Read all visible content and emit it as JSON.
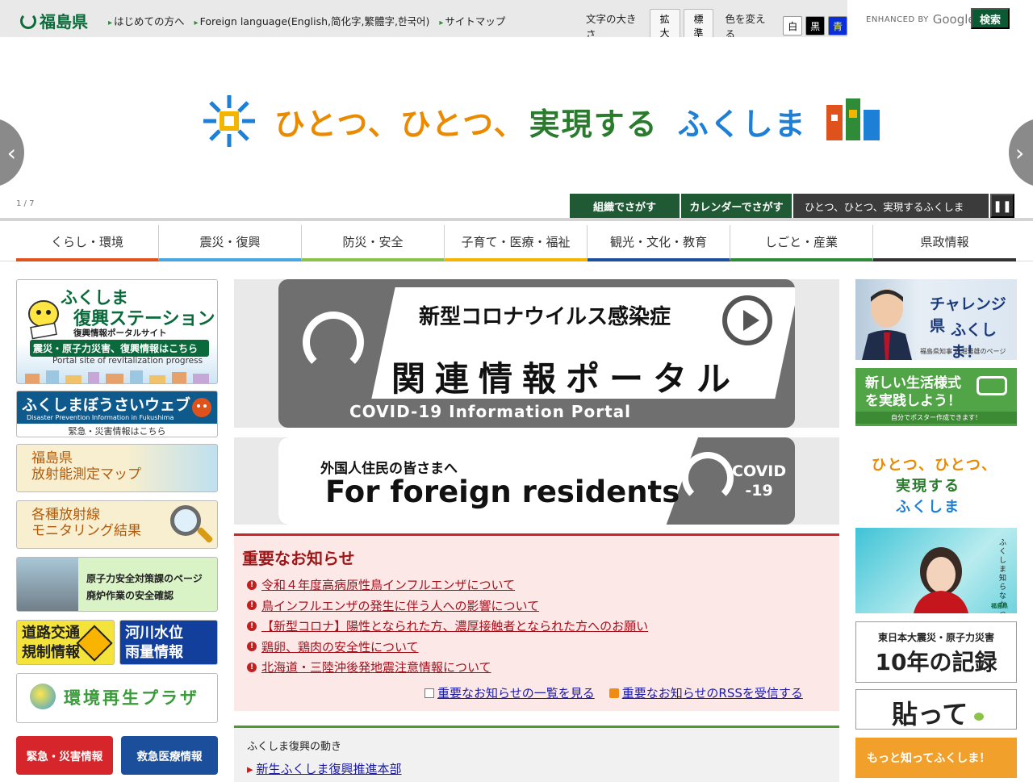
{
  "header": {
    "logo": "福島県",
    "links": [
      "はじめての方へ",
      "Foreign language(English,简化字,繁體字,한국어)",
      "サイトマップ"
    ],
    "font_size_label": "文字の大きさ",
    "font_size_buttons": [
      "拡大",
      "標準"
    ],
    "color_label": "色を変える",
    "color_buttons": [
      "白",
      "黒",
      "青"
    ],
    "search_enhanced": "ENHANCED BY",
    "search_google": "Google",
    "search_button": "検索"
  },
  "hero": {
    "title_parts": [
      "ひとつ、ひとつ、",
      "実現する",
      "ふくしま"
    ],
    "counter": "1 / 7",
    "prev": "‹",
    "next": "›",
    "tabs": [
      "組織でさがす",
      "カレンダーでさがす"
    ],
    "current_slide": "ひとつ、ひとつ、実現するふくしま",
    "pause": "❚❚"
  },
  "nav": [
    {
      "label": "くらし・環境",
      "color": "#e0521c"
    },
    {
      "label": "震災・復興",
      "color": "#48a7e0"
    },
    {
      "label": "防災・安全",
      "color": "#8bc34a"
    },
    {
      "label": "子育て・医療・福祉",
      "color": "#f5b400"
    },
    {
      "label": "観光・文化・教育",
      "color": "#1d4f9c"
    },
    {
      "label": "しごと・産業",
      "color": "#2e8b37"
    },
    {
      "label": "県政情報",
      "color": "#333333"
    }
  ],
  "left": {
    "fukko": {
      "t1": "ふくしま",
      "t2": "復興ステーション",
      "t3": "復興情報ポータルサイト",
      "t4": "震災・原子力災害、復興情報はこちら",
      "t5": "Portal site of revitalization progress"
    },
    "bousai": {
      "t1": "ふくしまぼうさいウェブ",
      "t2": "Disaster Prevention Information in Fukushima",
      "t3": "緊急・災害情報はこちら"
    },
    "map": [
      "福島県",
      "放射能測定マップ"
    ],
    "monitor": [
      "各種放射線",
      "モニタリング結果"
    ],
    "gensi": [
      "原子力安全対策課のページ",
      "廃炉作業の安全確認"
    ],
    "road": [
      "道路交通",
      "規制情報"
    ],
    "river": [
      "河川水位",
      "雨量情報"
    ],
    "env": "環境再生プラザ",
    "emergency": "緊急・災害情報",
    "medical": "救急医療情報"
  },
  "center": {
    "covid": {
      "t1": "新型コロナウイルス感染症",
      "t2": "関連情報ポータル",
      "t3": "COVID-19  Information  Portal"
    },
    "foreign": {
      "t1": "外国人住民の皆さまへ",
      "t2": "For foreign residents",
      "t3": [
        "COVID",
        "-19"
      ]
    },
    "notice": {
      "title": "重要なお知らせ",
      "items": [
        "令和４年度高病原性鳥インフルエンザについて",
        "鳥インフルエンザの発生に伴う人への影響について",
        "【新型コロナ】陽性となられた方、濃厚接触者となられた方へのお願い",
        "鶏卵、鶏肉の安全性について",
        "北海道・三陸沖後発地震注意情報について"
      ],
      "list_link": "重要なお知らせの一覧を見る",
      "rss_link": "重要なお知らせのRSSを受信する"
    },
    "fukko": {
      "title": "ふくしま復興の動き",
      "link": "新生ふくしま復興推進本部"
    }
  },
  "right": {
    "challenge": {
      "t1": "チャレンジ県",
      "t2": "ふくしま！",
      "t3": "福島県知事 内堀雅雄のページ"
    },
    "newlife": {
      "t1": [
        "新しい生活様式",
        "を実践しよう！"
      ],
      "t2": "自分でポスター作成できます！"
    },
    "hitotsu": [
      "ひとつ、ひとつ、",
      "実現する",
      "ふくしま"
    ],
    "ambassador": {
      "t1": "ふくしま知らなかった大使",
      "t2": "福島県"
    },
    "kiroku": {
      "t1": "東日本大震災・原子力災害",
      "t2": "10年の記録"
    },
    "hatte": "貼って",
    "motto": "もっと知ってふくしま！"
  },
  "colors": {
    "green": "#0b6b3a",
    "red": "#c82828",
    "nav_border": "#d4d4d4"
  }
}
